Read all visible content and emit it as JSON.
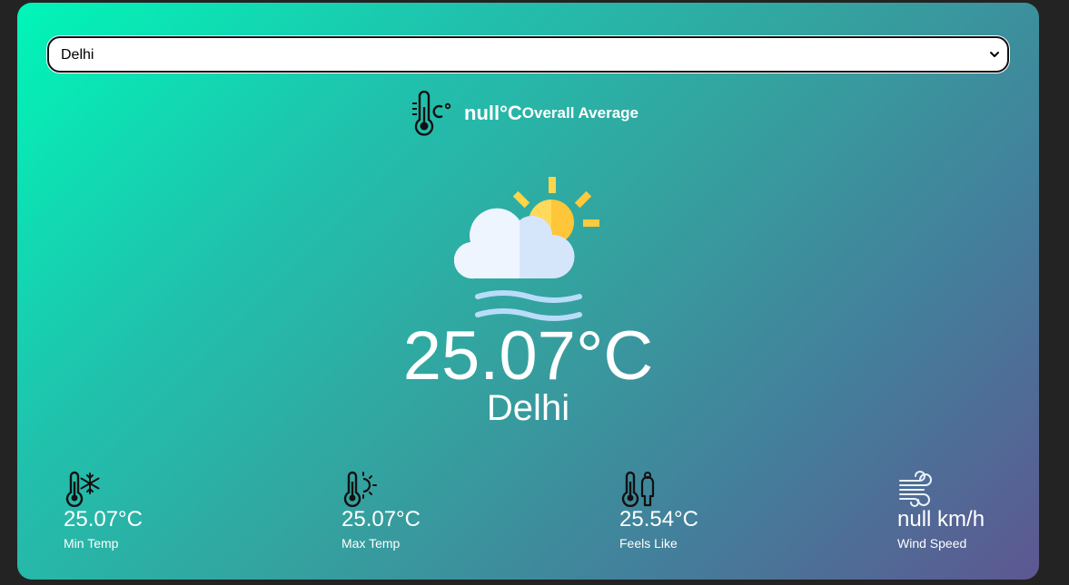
{
  "location_select": {
    "selected": "Delhi"
  },
  "overall": {
    "value": "null°C",
    "label": "Overall Average",
    "icon": "thermometer-celsius-icon"
  },
  "current": {
    "icon": "partly-cloudy-haze-icon",
    "temperature": "25.07°C",
    "city": "Delhi"
  },
  "stats": [
    {
      "icon": "thermometer-cold-icon",
      "value": "25.07°C",
      "label": "Min Temp"
    },
    {
      "icon": "thermometer-hot-icon",
      "value": "25.07°C",
      "label": "Max Temp"
    },
    {
      "icon": "thermometer-person-icon",
      "value": "25.54°C",
      "label": "Feels Like"
    },
    {
      "icon": "wind-icon",
      "value": "null km/h",
      "label": "Wind Speed"
    }
  ],
  "colors": {
    "gradient_start": "#00f6b8",
    "gradient_end": "#5d5791",
    "page_background": "#232323",
    "text": "#ffffff"
  }
}
